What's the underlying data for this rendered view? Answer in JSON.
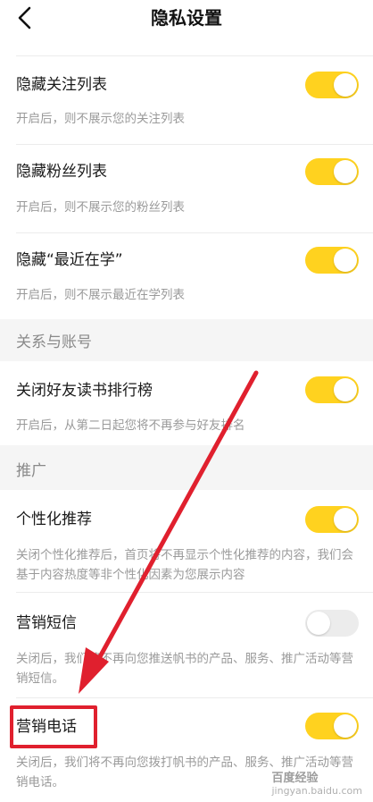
{
  "header": {
    "title": "隐私设置"
  },
  "settings": [
    {
      "label": "隐藏关注列表",
      "desc": "开启后，则不展示您的关注列表",
      "on": true
    },
    {
      "label": "隐藏粉丝列表",
      "desc": "开启后，则不展示您的粉丝列表",
      "on": true
    },
    {
      "label": "隐藏“最近在学”",
      "desc": "开启后，则不展示最近在学列表",
      "on": true
    },
    {
      "label": "关闭好友读书排行榜",
      "desc": "开启后，从第二日起您将不再参与好友排名",
      "on": true
    },
    {
      "label": "个性化推荐",
      "desc": "关闭个性化推荐后，首页将不再显示个性化推荐的内容，我们会基于内容热度等非个性化因素为您展示内容",
      "on": true
    },
    {
      "label": "营销短信",
      "desc": "关闭后，我们将不再向您推送帆书的产品、服务、推广活动等营销短信。",
      "on": false
    },
    {
      "label": "营销电话",
      "desc": "关闭后，我们将不再向您拨打帆书的产品、服务、推广活动等营销电话。",
      "on": true
    }
  ],
  "sections": {
    "relations": "关系与账号",
    "promotion": "推广"
  },
  "watermark": {
    "line1": "百度经验",
    "line2": "jingyan.baidu.com"
  },
  "colors": {
    "toggle_on": "#ffd21f",
    "toggle_off": "#ececec",
    "annotation_red": "#e0202e"
  }
}
